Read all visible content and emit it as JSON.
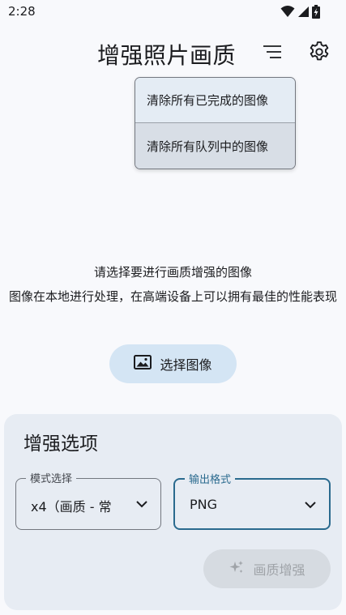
{
  "status_bar": {
    "time": "2:28",
    "icons": [
      "wifi-icon",
      "signal-icon",
      "battery-charging-icon"
    ]
  },
  "app_bar": {
    "title": "增强照片画质",
    "menu_icon": "sort-lines-icon",
    "settings_icon": "gear-icon"
  },
  "menu": {
    "items": [
      {
        "label": "清除所有已完成的图像"
      },
      {
        "label": "清除所有队列中的图像"
      }
    ]
  },
  "prompt": {
    "line1": "请选择要进行画质增强的图像",
    "line2": "图像在本地进行处理，在高端设备上可以拥有最佳的性能表现"
  },
  "select_button": {
    "label": "选择图像",
    "icon": "image-icon"
  },
  "options": {
    "title": "增强选项",
    "mode": {
      "label": "模式选择",
      "value": "x4（画质 - 常"
    },
    "format": {
      "label": "输出格式",
      "value": "PNG"
    },
    "enhance_button": {
      "label": "画质增强",
      "icon": "sparkle-icon",
      "enabled": false
    }
  },
  "colors": {
    "background": "#f8f9fc",
    "accent": "#2a6a8e",
    "select_button_bg": "#d4e5f4",
    "card_bg": "#e7ecf3"
  }
}
